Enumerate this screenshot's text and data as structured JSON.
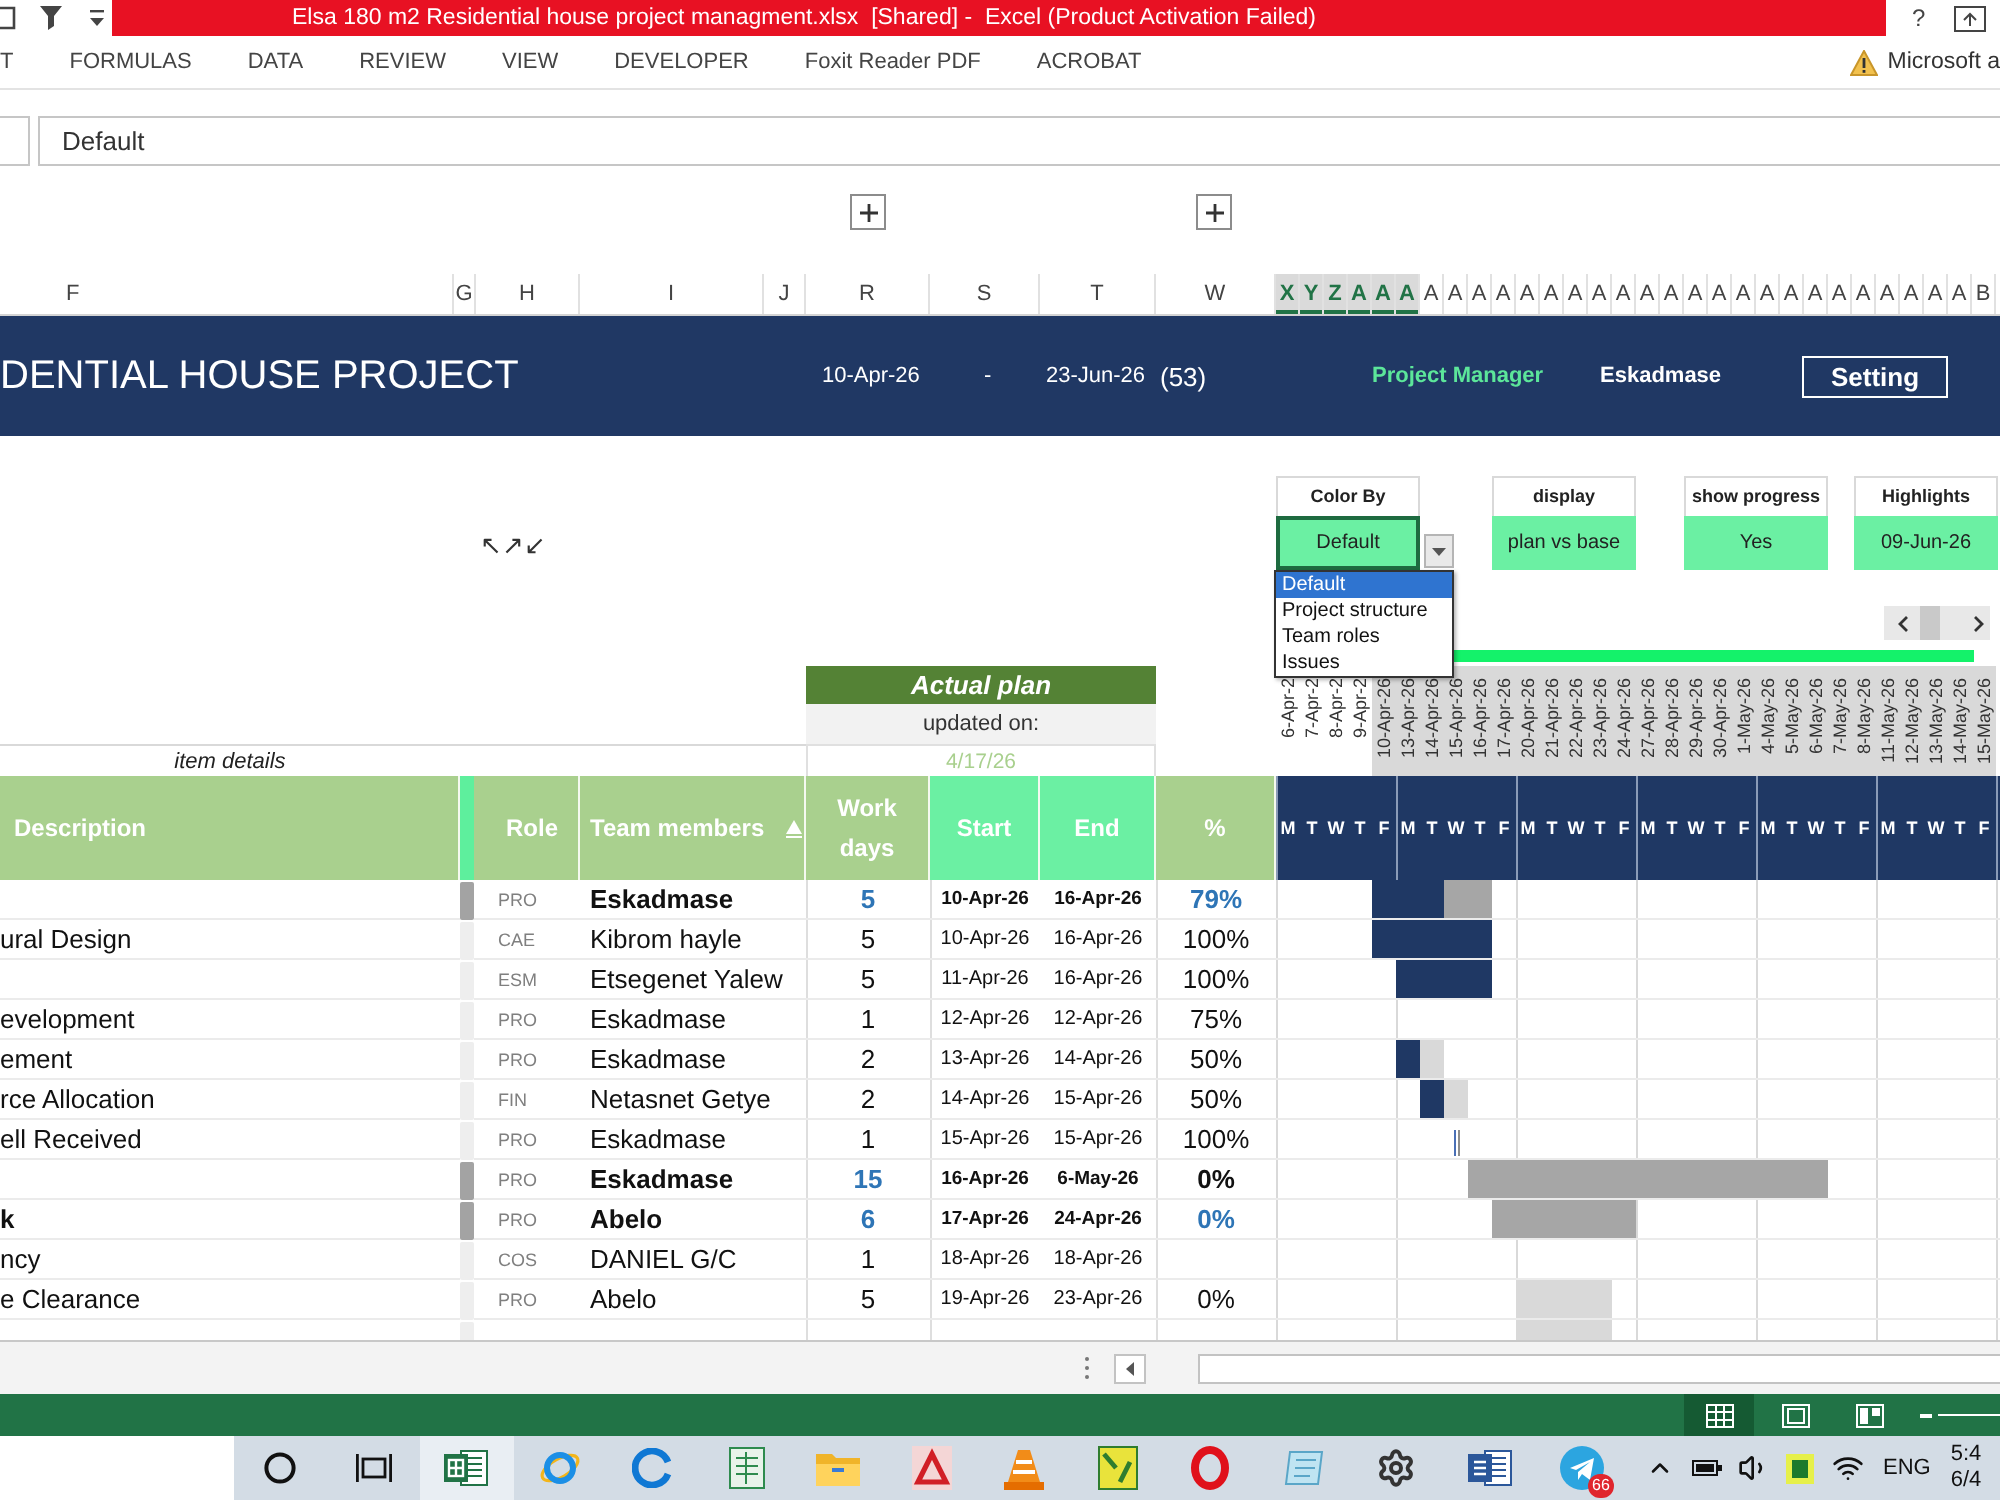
{
  "title_bar": {
    "title": "Elsa 180 m2 Residential house project managment.xlsx  [Shared] -  Excel (Product Activation Failed)",
    "help": "?"
  },
  "ribbon_tabs": [
    "T",
    "FORMULAS",
    "DATA",
    "REVIEW",
    "VIEW",
    "DEVELOPER",
    "Foxit Reader PDF",
    "ACROBAT"
  ],
  "account_notice": "Microsoft a",
  "formula_bar": {
    "value": "Default"
  },
  "column_headers": [
    {
      "label": "F",
      "selected": false
    },
    {
      "label": "G",
      "selected": false
    },
    {
      "label": "H",
      "selected": false
    },
    {
      "label": "I",
      "selected": false
    },
    {
      "label": "J",
      "selected": false
    },
    {
      "label": "R",
      "selected": false
    },
    {
      "label": "S",
      "selected": false
    },
    {
      "label": "T",
      "selected": false
    },
    {
      "label": "W",
      "selected": false
    },
    {
      "label": "X",
      "selected": true
    },
    {
      "label": "Y",
      "selected": true
    },
    {
      "label": "Z",
      "selected": true
    },
    {
      "label": "A",
      "selected": true
    },
    {
      "label": "A",
      "selected": true
    },
    {
      "label": "A",
      "selected": true
    },
    {
      "label": "A",
      "selected": false
    },
    {
      "label": "A",
      "selected": false
    },
    {
      "label": "A",
      "selected": false
    },
    {
      "label": "A",
      "selected": false
    },
    {
      "label": "A",
      "selected": false
    },
    {
      "label": "A",
      "selected": false
    },
    {
      "label": "A",
      "selected": false
    },
    {
      "label": "A",
      "selected": false
    },
    {
      "label": "A",
      "selected": false
    },
    {
      "label": "A",
      "selected": false
    },
    {
      "label": "A",
      "selected": false
    },
    {
      "label": "A",
      "selected": false
    },
    {
      "label": "A",
      "selected": false
    },
    {
      "label": "A",
      "selected": false
    },
    {
      "label": "A",
      "selected": false
    },
    {
      "label": "A",
      "selected": false
    },
    {
      "label": "A",
      "selected": false
    },
    {
      "label": "A",
      "selected": false
    },
    {
      "label": "A",
      "selected": false
    },
    {
      "label": "A",
      "selected": false
    },
    {
      "label": "A",
      "selected": false
    },
    {
      "label": "A",
      "selected": false
    },
    {
      "label": "A",
      "selected": false
    },
    {
      "label": "B",
      "selected": false
    }
  ],
  "banner": {
    "title": "DENTIAL HOUSE PROJECT",
    "start": "10-Apr-26",
    "separator": "-",
    "end": "23-Jun-26",
    "duration": "(53)",
    "manager_label": "Project Manager",
    "manager": "Eskadmase",
    "settings_button": "Setting"
  },
  "sheet_shape": "↖↗↙",
  "controls": [
    {
      "label": "Color By",
      "value": "Default",
      "active": true
    },
    {
      "label": "display",
      "value": "plan vs base",
      "active": false
    },
    {
      "label": "show progress",
      "value": "Yes",
      "active": false
    },
    {
      "label": "Highlights",
      "value": "09-Jun-26",
      "active": false
    }
  ],
  "dropdown_options": [
    {
      "label": "Default",
      "selected": true
    },
    {
      "label": "Project structure",
      "selected": false
    },
    {
      "label": "Team roles",
      "selected": false
    },
    {
      "label": "Issues",
      "selected": false
    }
  ],
  "actual_plan": {
    "title": "Actual plan",
    "updated_label": "updated on:",
    "updated_date": "4/17/26"
  },
  "item_details": "item details",
  "dates": [
    {
      "label": "6-Apr-2",
      "weekday": "M",
      "in_range": false
    },
    {
      "label": "7-Apr-2",
      "weekday": "T",
      "in_range": false
    },
    {
      "label": "8-Apr-2",
      "weekday": "W",
      "in_range": false
    },
    {
      "label": "9-Apr-2",
      "weekday": "T",
      "in_range": false
    },
    {
      "label": "10-Apr-26",
      "weekday": "F",
      "in_range": true
    },
    {
      "label": "13-Apr-26",
      "weekday": "M",
      "in_range": true
    },
    {
      "label": "14-Apr-26",
      "weekday": "T",
      "in_range": true
    },
    {
      "label": "15-Apr-26",
      "weekday": "W",
      "in_range": true
    },
    {
      "label": "16-Apr-26",
      "weekday": "T",
      "in_range": true
    },
    {
      "label": "17-Apr-26",
      "weekday": "F",
      "in_range": true
    },
    {
      "label": "20-Apr-26",
      "weekday": "M",
      "in_range": true
    },
    {
      "label": "21-Apr-26",
      "weekday": "T",
      "in_range": true
    },
    {
      "label": "22-Apr-26",
      "weekday": "W",
      "in_range": true
    },
    {
      "label": "23-Apr-26",
      "weekday": "T",
      "in_range": true
    },
    {
      "label": "24-Apr-26",
      "weekday": "F",
      "in_range": true
    },
    {
      "label": "27-Apr-26",
      "weekday": "M",
      "in_range": true
    },
    {
      "label": "28-Apr-26",
      "weekday": "T",
      "in_range": true
    },
    {
      "label": "29-Apr-26",
      "weekday": "W",
      "in_range": true
    },
    {
      "label": "30-Apr-26",
      "weekday": "T",
      "in_range": true
    },
    {
      "label": "1-May-26",
      "weekday": "F",
      "in_range": true
    },
    {
      "label": "4-May-26",
      "weekday": "M",
      "in_range": true
    },
    {
      "label": "5-May-26",
      "weekday": "T",
      "in_range": true
    },
    {
      "label": "6-May-26",
      "weekday": "W",
      "in_range": true
    },
    {
      "label": "7-May-26",
      "weekday": "T",
      "in_range": true
    },
    {
      "label": "8-May-26",
      "weekday": "F",
      "in_range": true
    },
    {
      "label": "11-May-26",
      "weekday": "M",
      "in_range": true
    },
    {
      "label": "12-May-26",
      "weekday": "T",
      "in_range": true
    },
    {
      "label": "13-May-26",
      "weekday": "W",
      "in_range": true
    },
    {
      "label": "14-May-26",
      "weekday": "T",
      "in_range": true
    },
    {
      "label": "15-May-26",
      "weekday": "F",
      "in_range": true
    }
  ],
  "table": {
    "columns": [
      "Description",
      "Role",
      "Team members",
      "Work days",
      "Start",
      "End",
      "%"
    ],
    "rows": [
      {
        "role": "PRO",
        "member": "Eskadmase",
        "work_days": "5",
        "start": "10-Apr-26",
        "end": "16-Apr-26",
        "percent": "79%",
        "summary": true,
        "percent_highlighted": true,
        "timeline": [
          {
            "kind": "none"
          },
          {
            "kind": "none"
          },
          {
            "kind": "none"
          },
          {
            "kind": "none"
          },
          {
            "kind": "done"
          },
          {
            "kind": "done"
          },
          {
            "kind": "done"
          },
          {
            "kind": "planned"
          },
          {
            "kind": "planned"
          },
          {
            "kind": "none"
          },
          {
            "kind": "none"
          },
          {
            "kind": "none"
          },
          {
            "kind": "none"
          },
          {
            "kind": "none"
          },
          {
            "kind": "none"
          },
          {
            "kind": "none"
          },
          {
            "kind": "none"
          },
          {
            "kind": "none"
          },
          {
            "kind": "none"
          },
          {
            "kind": "none"
          },
          {
            "kind": "none"
          },
          {
            "kind": "none"
          },
          {
            "kind": "none"
          },
          {
            "kind": "none"
          },
          {
            "kind": "none"
          },
          {
            "kind": "none"
          },
          {
            "kind": "none"
          },
          {
            "kind": "none"
          },
          {
            "kind": "none"
          },
          {
            "kind": "none"
          }
        ]
      },
      {
        "description": "ural Design",
        "role": "CAE",
        "member": "Kibrom hayle",
        "work_days": "5",
        "start": "10-Apr-26",
        "end": "16-Apr-26",
        "percent": "100%",
        "summary": false,
        "percent_highlighted": false,
        "timeline": [
          {
            "kind": "none"
          },
          {
            "kind": "none"
          },
          {
            "kind": "none"
          },
          {
            "kind": "none"
          },
          {
            "kind": "done"
          },
          {
            "kind": "done"
          },
          {
            "kind": "done"
          },
          {
            "kind": "done"
          },
          {
            "kind": "done"
          },
          {
            "kind": "none"
          },
          {
            "kind": "none"
          },
          {
            "kind": "none"
          },
          {
            "kind": "none"
          },
          {
            "kind": "none"
          },
          {
            "kind": "none"
          },
          {
            "kind": "none"
          },
          {
            "kind": "none"
          },
          {
            "kind": "none"
          },
          {
            "kind": "none"
          },
          {
            "kind": "none"
          },
          {
            "kind": "none"
          },
          {
            "kind": "none"
          },
          {
            "kind": "none"
          },
          {
            "kind": "none"
          },
          {
            "kind": "none"
          },
          {
            "kind": "none"
          },
          {
            "kind": "none"
          },
          {
            "kind": "none"
          },
          {
            "kind": "none"
          },
          {
            "kind": "none"
          }
        ]
      },
      {
        "role": "ESM",
        "member": "Etsegenet Yalew",
        "work_days": "5",
        "start": "11-Apr-26",
        "end": "16-Apr-26",
        "percent": "100%",
        "summary": false,
        "percent_highlighted": false,
        "timeline": [
          {
            "kind": "none"
          },
          {
            "kind": "none"
          },
          {
            "kind": "none"
          },
          {
            "kind": "none"
          },
          {
            "kind": "none"
          },
          {
            "kind": "done"
          },
          {
            "kind": "done"
          },
          {
            "kind": "done"
          },
          {
            "kind": "done"
          },
          {
            "kind": "none"
          },
          {
            "kind": "none"
          },
          {
            "kind": "none"
          },
          {
            "kind": "none"
          },
          {
            "kind": "none"
          },
          {
            "kind": "none"
          },
          {
            "kind": "none"
          },
          {
            "kind": "none"
          },
          {
            "kind": "none"
          },
          {
            "kind": "none"
          },
          {
            "kind": "none"
          },
          {
            "kind": "none"
          },
          {
            "kind": "none"
          },
          {
            "kind": "none"
          },
          {
            "kind": "none"
          },
          {
            "kind": "none"
          },
          {
            "kind": "none"
          },
          {
            "kind": "none"
          },
          {
            "kind": "none"
          },
          {
            "kind": "none"
          },
          {
            "kind": "none"
          }
        ]
      },
      {
        "description": "evelopment",
        "role": "PRO",
        "member": "Eskadmase",
        "work_days": "1",
        "start": "12-Apr-26",
        "end": "12-Apr-26",
        "percent": "75%",
        "summary": false,
        "percent_highlighted": false,
        "timeline": [
          {
            "kind": "none"
          },
          {
            "kind": "none"
          },
          {
            "kind": "none"
          },
          {
            "kind": "none"
          },
          {
            "kind": "none"
          },
          {
            "kind": "none"
          },
          {
            "kind": "none"
          },
          {
            "kind": "none"
          },
          {
            "kind": "none"
          },
          {
            "kind": "none"
          },
          {
            "kind": "none"
          },
          {
            "kind": "none"
          },
          {
            "kind": "none"
          },
          {
            "kind": "none"
          },
          {
            "kind": "none"
          },
          {
            "kind": "none"
          },
          {
            "kind": "none"
          },
          {
            "kind": "none"
          },
          {
            "kind": "none"
          },
          {
            "kind": "none"
          },
          {
            "kind": "none"
          },
          {
            "kind": "none"
          },
          {
            "kind": "none"
          },
          {
            "kind": "none"
          },
          {
            "kind": "none"
          },
          {
            "kind": "none"
          },
          {
            "kind": "none"
          },
          {
            "kind": "none"
          },
          {
            "kind": "none"
          },
          {
            "kind": "none"
          }
        ]
      },
      {
        "description": "ement",
        "role": "PRO",
        "member": "Eskadmase",
        "work_days": "2",
        "start": "13-Apr-26",
        "end": "14-Apr-26",
        "percent": "50%",
        "summary": false,
        "percent_highlighted": false,
        "timeline": [
          {
            "kind": "none"
          },
          {
            "kind": "none"
          },
          {
            "kind": "none"
          },
          {
            "kind": "none"
          },
          {
            "kind": "none"
          },
          {
            "kind": "done"
          },
          {
            "kind": "pending"
          },
          {
            "kind": "none"
          },
          {
            "kind": "none"
          },
          {
            "kind": "none"
          },
          {
            "kind": "none"
          },
          {
            "kind": "none"
          },
          {
            "kind": "none"
          },
          {
            "kind": "none"
          },
          {
            "kind": "none"
          },
          {
            "kind": "none"
          },
          {
            "kind": "none"
          },
          {
            "kind": "none"
          },
          {
            "kind": "none"
          },
          {
            "kind": "none"
          },
          {
            "kind": "none"
          },
          {
            "kind": "none"
          },
          {
            "kind": "none"
          },
          {
            "kind": "none"
          },
          {
            "kind": "none"
          },
          {
            "kind": "none"
          },
          {
            "kind": "none"
          },
          {
            "kind": "none"
          },
          {
            "kind": "none"
          },
          {
            "kind": "none"
          }
        ]
      },
      {
        "description": "rce Allocation",
        "role": "FIN",
        "member": "Netasnet Getye",
        "work_days": "2",
        "start": "14-Apr-26",
        "end": "15-Apr-26",
        "percent": "50%",
        "summary": false,
        "percent_highlighted": false,
        "timeline": [
          {
            "kind": "none"
          },
          {
            "kind": "none"
          },
          {
            "kind": "none"
          },
          {
            "kind": "none"
          },
          {
            "kind": "none"
          },
          {
            "kind": "none"
          },
          {
            "kind": "done"
          },
          {
            "kind": "pending"
          },
          {
            "kind": "none"
          },
          {
            "kind": "none"
          },
          {
            "kind": "none"
          },
          {
            "kind": "none"
          },
          {
            "kind": "none"
          },
          {
            "kind": "none"
          },
          {
            "kind": "none"
          },
          {
            "kind": "none"
          },
          {
            "kind": "none"
          },
          {
            "kind": "none"
          },
          {
            "kind": "none"
          },
          {
            "kind": "none"
          },
          {
            "kind": "none"
          },
          {
            "kind": "none"
          },
          {
            "kind": "none"
          },
          {
            "kind": "none"
          },
          {
            "kind": "none"
          },
          {
            "kind": "none"
          },
          {
            "kind": "none"
          },
          {
            "kind": "none"
          },
          {
            "kind": "none"
          },
          {
            "kind": "none"
          }
        ]
      },
      {
        "description": "ell Received",
        "role": "PRO",
        "member": "Eskadmase",
        "work_days": "1",
        "start": "15-Apr-26",
        "end": "15-Apr-26",
        "percent": "100%",
        "summary": false,
        "percent_highlighted": false,
        "timeline": [
          {
            "kind": "none"
          },
          {
            "kind": "none"
          },
          {
            "kind": "none"
          },
          {
            "kind": "none"
          },
          {
            "kind": "none"
          },
          {
            "kind": "none"
          },
          {
            "kind": "none"
          },
          {
            "kind": "milestone"
          },
          {
            "kind": "none"
          },
          {
            "kind": "none"
          },
          {
            "kind": "none"
          },
          {
            "kind": "none"
          },
          {
            "kind": "none"
          },
          {
            "kind": "none"
          },
          {
            "kind": "none"
          },
          {
            "kind": "none"
          },
          {
            "kind": "none"
          },
          {
            "kind": "none"
          },
          {
            "kind": "none"
          },
          {
            "kind": "none"
          },
          {
            "kind": "none"
          },
          {
            "kind": "none"
          },
          {
            "kind": "none"
          },
          {
            "kind": "none"
          },
          {
            "kind": "none"
          },
          {
            "kind": "none"
          },
          {
            "kind": "none"
          },
          {
            "kind": "none"
          },
          {
            "kind": "none"
          },
          {
            "kind": "none"
          }
        ]
      },
      {
        "role": "PRO",
        "member": "Eskadmase",
        "work_days": "15",
        "start": "16-Apr-26",
        "end": "6-May-26",
        "percent": "0%",
        "summary": true,
        "percent_highlighted": false,
        "timeline": [
          {
            "kind": "none"
          },
          {
            "kind": "none"
          },
          {
            "kind": "none"
          },
          {
            "kind": "none"
          },
          {
            "kind": "none"
          },
          {
            "kind": "none"
          },
          {
            "kind": "none"
          },
          {
            "kind": "none"
          },
          {
            "kind": "planned"
          },
          {
            "kind": "planned"
          },
          {
            "kind": "planned"
          },
          {
            "kind": "planned"
          },
          {
            "kind": "planned"
          },
          {
            "kind": "planned"
          },
          {
            "kind": "planned"
          },
          {
            "kind": "planned"
          },
          {
            "kind": "planned"
          },
          {
            "kind": "planned"
          },
          {
            "kind": "planned"
          },
          {
            "kind": "planned"
          },
          {
            "kind": "planned"
          },
          {
            "kind": "planned"
          },
          {
            "kind": "planned"
          },
          {
            "kind": "none"
          },
          {
            "kind": "none"
          },
          {
            "kind": "none"
          },
          {
            "kind": "none"
          },
          {
            "kind": "none"
          },
          {
            "kind": "none"
          },
          {
            "kind": "none"
          }
        ]
      },
      {
        "description": "k",
        "role": "PRO",
        "member": "Abelo",
        "work_days": "6",
        "start": "17-Apr-26",
        "end": "24-Apr-26",
        "percent": "0%",
        "summary": true,
        "percent_highlighted": true,
        "timeline": [
          {
            "kind": "none"
          },
          {
            "kind": "none"
          },
          {
            "kind": "none"
          },
          {
            "kind": "none"
          },
          {
            "kind": "none"
          },
          {
            "kind": "none"
          },
          {
            "kind": "none"
          },
          {
            "kind": "none"
          },
          {
            "kind": "none"
          },
          {
            "kind": "planned"
          },
          {
            "kind": "planned"
          },
          {
            "kind": "planned"
          },
          {
            "kind": "planned"
          },
          {
            "kind": "planned"
          },
          {
            "kind": "planned"
          },
          {
            "kind": "none"
          },
          {
            "kind": "none"
          },
          {
            "kind": "none"
          },
          {
            "kind": "none"
          },
          {
            "kind": "none"
          },
          {
            "kind": "none"
          },
          {
            "kind": "none"
          },
          {
            "kind": "none"
          },
          {
            "kind": "none"
          },
          {
            "kind": "none"
          },
          {
            "kind": "none"
          },
          {
            "kind": "none"
          },
          {
            "kind": "none"
          },
          {
            "kind": "none"
          },
          {
            "kind": "none"
          }
        ]
      },
      {
        "description": "ncy",
        "role": "COS",
        "member": "DANIEL G/C",
        "work_days": "1",
        "start": "18-Apr-26",
        "end": "18-Apr-26",
        "summary": false,
        "timeline": [
          {
            "kind": "none"
          },
          {
            "kind": "none"
          },
          {
            "kind": "none"
          },
          {
            "kind": "none"
          },
          {
            "kind": "none"
          },
          {
            "kind": "none"
          },
          {
            "kind": "none"
          },
          {
            "kind": "none"
          },
          {
            "kind": "none"
          },
          {
            "kind": "none"
          },
          {
            "kind": "none"
          },
          {
            "kind": "none"
          },
          {
            "kind": "none"
          },
          {
            "kind": "none"
          },
          {
            "kind": "none"
          },
          {
            "kind": "none"
          },
          {
            "kind": "none"
          },
          {
            "kind": "none"
          },
          {
            "kind": "none"
          },
          {
            "kind": "none"
          },
          {
            "kind": "none"
          },
          {
            "kind": "none"
          },
          {
            "kind": "none"
          },
          {
            "kind": "none"
          },
          {
            "kind": "none"
          },
          {
            "kind": "none"
          },
          {
            "kind": "none"
          },
          {
            "kind": "none"
          },
          {
            "kind": "none"
          },
          {
            "kind": "none"
          }
        ]
      },
      {
        "description": "e Clearance",
        "role": "PRO",
        "member": "Abelo",
        "work_days": "5",
        "start": "19-Apr-26",
        "end": "23-Apr-26",
        "percent": "0%",
        "summary": false,
        "percent_highlighted": false,
        "timeline": [
          {
            "kind": "none"
          },
          {
            "kind": "none"
          },
          {
            "kind": "none"
          },
          {
            "kind": "none"
          },
          {
            "kind": "none"
          },
          {
            "kind": "none"
          },
          {
            "kind": "none"
          },
          {
            "kind": "none"
          },
          {
            "kind": "none"
          },
          {
            "kind": "none"
          },
          {
            "kind": "pending"
          },
          {
            "kind": "pending"
          },
          {
            "kind": "pending"
          },
          {
            "kind": "pending"
          },
          {
            "kind": "none"
          },
          {
            "kind": "none"
          },
          {
            "kind": "none"
          },
          {
            "kind": "none"
          },
          {
            "kind": "none"
          },
          {
            "kind": "none"
          },
          {
            "kind": "none"
          },
          {
            "kind": "none"
          },
          {
            "kind": "none"
          },
          {
            "kind": "none"
          },
          {
            "kind": "none"
          },
          {
            "kind": "none"
          },
          {
            "kind": "none"
          },
          {
            "kind": "none"
          },
          {
            "kind": "none"
          },
          {
            "kind": "none"
          }
        ]
      },
      {
        "summary": false,
        "timeline": [
          {
            "kind": "none"
          },
          {
            "kind": "none"
          },
          {
            "kind": "none"
          },
          {
            "kind": "none"
          },
          {
            "kind": "none"
          },
          {
            "kind": "none"
          },
          {
            "kind": "none"
          },
          {
            "kind": "none"
          },
          {
            "kind": "none"
          },
          {
            "kind": "none"
          },
          {
            "kind": "pending"
          },
          {
            "kind": "pending"
          },
          {
            "kind": "pending"
          },
          {
            "kind": "pending"
          },
          {
            "kind": "none"
          },
          {
            "kind": "none"
          },
          {
            "kind": "none"
          },
          {
            "kind": "none"
          },
          {
            "kind": "none"
          },
          {
            "kind": "none"
          },
          {
            "kind": "none"
          },
          {
            "kind": "none"
          },
          {
            "kind": "none"
          },
          {
            "kind": "none"
          },
          {
            "kind": "none"
          },
          {
            "kind": "none"
          },
          {
            "kind": "none"
          },
          {
            "kind": "none"
          },
          {
            "kind": "none"
          },
          {
            "kind": "none"
          }
        ]
      }
    ]
  },
  "status_bar": {
    "views": [
      {
        "kind": "normal",
        "selected": true
      },
      {
        "kind": "page_layout",
        "selected": false
      },
      {
        "kind": "page_break",
        "selected": false
      }
    ]
  },
  "taskbar": {
    "apps": [
      {
        "kind": "search",
        "active": false
      },
      {
        "kind": "task_view",
        "active": false
      },
      {
        "kind": "excel",
        "active": true
      },
      {
        "kind": "internet_explorer",
        "active": false
      },
      {
        "kind": "edge",
        "active": false
      },
      {
        "kind": "excel_file",
        "active": false
      },
      {
        "kind": "file_explorer",
        "active": false
      },
      {
        "kind": "acrobat",
        "active": false
      },
      {
        "kind": "vlc",
        "active": false
      },
      {
        "kind": "dictionary",
        "active": false
      },
      {
        "kind": "opera",
        "active": false
      },
      {
        "kind": "notepad",
        "active": false
      },
      {
        "kind": "settings",
        "active": false
      },
      {
        "kind": "word",
        "active": false
      },
      {
        "kind": "telegram",
        "active": false,
        "badge": "66"
      }
    ],
    "language": "ENG",
    "time": "5:4",
    "date": "6/4"
  }
}
